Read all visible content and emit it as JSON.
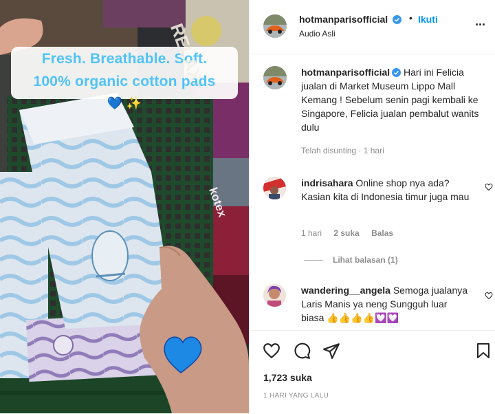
{
  "post": {
    "username": "hotmanparisofficial",
    "follow_label": "Ikuti",
    "audio": "Audio Asli",
    "more_glyph": "···"
  },
  "media": {
    "overlay_line1": "Fresh. Breathable. Soft.",
    "overlay_line2": "100% organic cotton pads",
    "overlay_emoji": "💙 ✨",
    "shelf_text_1": "RELAX",
    "shelf_text_2": "kotex"
  },
  "caption": {
    "username": "hotmanparisofficial",
    "text": "Hari ini Felicia jualan di Market Museum Lippo Mall Kemang ! Sebelum senin pagi kembali ke Singapore, Felicia jualan pembalut wanits dulu",
    "edited": "Telah disunting · 1 hari"
  },
  "comments": [
    {
      "username": "indrisahara",
      "text": "Online shop nya ada? Kasian kita di Indonesia timur juga mau",
      "time": "1 hari",
      "likes": "2 suka",
      "reply": "Balas",
      "view_replies": "Lihat balasan (1)"
    },
    {
      "username": "wandering__angela",
      "text": "Semoga jualanya Laris Manis ya neng Sungguh luar biasa 👍👍👍👍💟💟"
    }
  ],
  "actions": {
    "likes_count": "1,723 suka",
    "date": "1 HARI YANG LALU"
  },
  "colors": {
    "accent": "#0095f6",
    "verified": "#3897f0",
    "overlay_text": "#4fc3f7"
  }
}
